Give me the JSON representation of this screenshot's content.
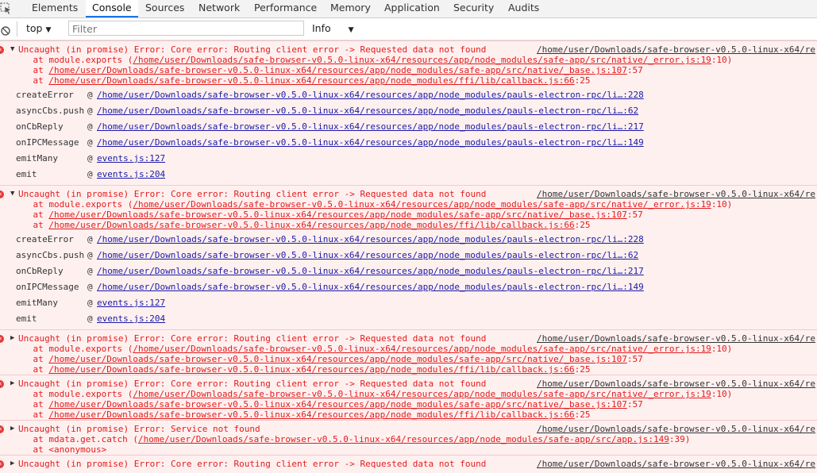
{
  "tabs": [
    "Elements",
    "Console",
    "Sources",
    "Network",
    "Performance",
    "Memory",
    "Application",
    "Security",
    "Audits"
  ],
  "toolbar": {
    "context": "top",
    "filter_placeholder": "Filter",
    "level": "Info"
  },
  "messages": [
    {
      "expanded": true,
      "head": "Uncaught (in promise) Error: Core error: Routing client error -> Requested data not found",
      "source": "/home/user/Downloads/safe-browser-v0.5.0-linux-x64/re",
      "lines": [
        {
          "pre": "    at module.exports (",
          "link": "/home/user/Downloads/safe-browser-v0.5.0-linux-x64/resources/app/node_modules/safe-app/src/native/_error.js:19",
          "post": ":10)"
        },
        {
          "pre": "    at ",
          "link": "/home/user/Downloads/safe-browser-v0.5.0-linux-x64/resources/app/node_modules/safe-app/src/native/_base.js:107",
          "post": ":57"
        },
        {
          "pre": "    at ",
          "link": "/home/user/Downloads/safe-browser-v0.5.0-linux-x64/resources/app/node_modules/ffi/lib/callback.js:66",
          "post": ":25"
        }
      ],
      "stack": [
        {
          "fn": "createError",
          "link": "/home/user/Downloads/safe-browser-v0.5.0-linux-x64/resources/app/node_modules/pauls-electron-rpc/li…:228"
        },
        {
          "fn": "asyncCbs.push",
          "link": "/home/user/Downloads/safe-browser-v0.5.0-linux-x64/resources/app/node_modules/pauls-electron-rpc/li…:62"
        },
        {
          "fn": "onCbReply",
          "link": "/home/user/Downloads/safe-browser-v0.5.0-linux-x64/resources/app/node_modules/pauls-electron-rpc/li…:217"
        },
        {
          "fn": "onIPCMessage",
          "link": "/home/user/Downloads/safe-browser-v0.5.0-linux-x64/resources/app/node_modules/pauls-electron-rpc/li…:149"
        },
        {
          "fn": "emitMany",
          "link": "events.js:127"
        },
        {
          "fn": "emit",
          "link": "events.js:204"
        }
      ]
    },
    {
      "expanded": true,
      "head": "Uncaught (in promise) Error: Core error: Routing client error -> Requested data not found",
      "source": "/home/user/Downloads/safe-browser-v0.5.0-linux-x64/re",
      "lines": [
        {
          "pre": "    at module.exports (",
          "link": "/home/user/Downloads/safe-browser-v0.5.0-linux-x64/resources/app/node_modules/safe-app/src/native/_error.js:19",
          "post": ":10)"
        },
        {
          "pre": "    at ",
          "link": "/home/user/Downloads/safe-browser-v0.5.0-linux-x64/resources/app/node_modules/safe-app/src/native/_base.js:107",
          "post": ":57"
        },
        {
          "pre": "    at ",
          "link": "/home/user/Downloads/safe-browser-v0.5.0-linux-x64/resources/app/node_modules/ffi/lib/callback.js:66",
          "post": ":25"
        }
      ],
      "stack": [
        {
          "fn": "createError",
          "link": "/home/user/Downloads/safe-browser-v0.5.0-linux-x64/resources/app/node_modules/pauls-electron-rpc/li…:228"
        },
        {
          "fn": "asyncCbs.push",
          "link": "/home/user/Downloads/safe-browser-v0.5.0-linux-x64/resources/app/node_modules/pauls-electron-rpc/li…:62"
        },
        {
          "fn": "onCbReply",
          "link": "/home/user/Downloads/safe-browser-v0.5.0-linux-x64/resources/app/node_modules/pauls-electron-rpc/li…:217"
        },
        {
          "fn": "onIPCMessage",
          "link": "/home/user/Downloads/safe-browser-v0.5.0-linux-x64/resources/app/node_modules/pauls-electron-rpc/li…:149"
        },
        {
          "fn": "emitMany",
          "link": "events.js:127"
        },
        {
          "fn": "emit",
          "link": "events.js:204"
        }
      ]
    },
    {
      "expanded": false,
      "head": "Uncaught (in promise) Error: Core error: Routing client error -> Requested data not found",
      "source": "/home/user/Downloads/safe-browser-v0.5.0-linux-x64/re",
      "lines": [
        {
          "pre": "    at module.exports (",
          "link": "/home/user/Downloads/safe-browser-v0.5.0-linux-x64/resources/app/node_modules/safe-app/src/native/_error.js:19",
          "post": ":10)"
        },
        {
          "pre": "    at ",
          "link": "/home/user/Downloads/safe-browser-v0.5.0-linux-x64/resources/app/node_modules/safe-app/src/native/_base.js:107",
          "post": ":57"
        },
        {
          "pre": "    at ",
          "link": "/home/user/Downloads/safe-browser-v0.5.0-linux-x64/resources/app/node_modules/ffi/lib/callback.js:66",
          "post": ":25"
        }
      ],
      "stack": []
    },
    {
      "expanded": false,
      "head": "Uncaught (in promise) Error: Core error: Routing client error -> Requested data not found",
      "source": "/home/user/Downloads/safe-browser-v0.5.0-linux-x64/re",
      "lines": [
        {
          "pre": "    at module.exports (",
          "link": "/home/user/Downloads/safe-browser-v0.5.0-linux-x64/resources/app/node_modules/safe-app/src/native/_error.js:19",
          "post": ":10)"
        },
        {
          "pre": "    at ",
          "link": "/home/user/Downloads/safe-browser-v0.5.0-linux-x64/resources/app/node_modules/safe-app/src/native/_base.js:107",
          "post": ":57"
        },
        {
          "pre": "    at ",
          "link": "/home/user/Downloads/safe-browser-v0.5.0-linux-x64/resources/app/node_modules/ffi/lib/callback.js:66",
          "post": ":25"
        }
      ],
      "stack": []
    },
    {
      "expanded": false,
      "head": "Uncaught (in promise) Error: Service not found",
      "source": "/home/user/Downloads/safe-browser-v0.5.0-linux-x64/re",
      "lines": [
        {
          "pre": "    at mdata.get.catch (",
          "link": "/home/user/Downloads/safe-browser-v0.5.0-linux-x64/resources/app/node_modules/safe-app/src/app.js:149",
          "post": ":39)"
        },
        {
          "pre": "    at <anonymous>",
          "link": "",
          "post": ""
        }
      ],
      "stack": []
    },
    {
      "expanded": false,
      "head": "Uncaught (in promise) Error: Core error: Routing client error -> Requested data not found",
      "source": "/home/user/Downloads/safe-browser-v0.5.0-linux-x64/re",
      "lines": [],
      "stack": []
    }
  ]
}
